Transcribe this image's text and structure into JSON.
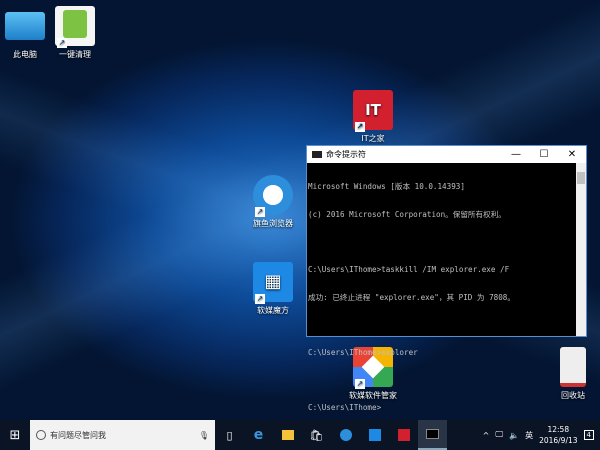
{
  "desktop": {
    "icons": [
      {
        "label": "此电脑",
        "name": "this-pc",
        "color": "#3fa5e0"
      },
      {
        "label": "一键清理",
        "name": "one-click-clean",
        "color": "#7dc242"
      },
      {
        "label": "IT之家",
        "name": "ithome",
        "color": "#d2202f"
      },
      {
        "label": "旗鱼浏览器",
        "name": "qiyu-browser",
        "color": "#2d8fdc"
      },
      {
        "label": "软媒魔方",
        "name": "ruanmei-mofang",
        "color": "#1e88e5"
      },
      {
        "label": "软媒软件管家",
        "name": "ruanmei-software-manager",
        "color": "#f4b400"
      },
      {
        "label": "回收站",
        "name": "recycle-bin",
        "color": "#eee"
      }
    ]
  },
  "cmd": {
    "title": "命令提示符",
    "minimize": "—",
    "maximize": "☐",
    "close": "✕",
    "lines": [
      "Microsoft Windows [版本 10.0.14393]",
      "(c) 2016 Microsoft Corporation。保留所有权利。",
      "",
      "C:\\Users\\IThome>taskkill /IM explorer.exe /F",
      "成功: 已终止进程 \"explorer.exe\"，其 PID 为 7808。",
      "",
      "C:\\Users\\IThome>explorer",
      "",
      "C:\\Users\\IThome>"
    ]
  },
  "taskbar": {
    "search_placeholder": "有问题尽管问我",
    "ime": "英",
    "time": "12:58",
    "date": "2016/9/13",
    "notifications": "4"
  }
}
